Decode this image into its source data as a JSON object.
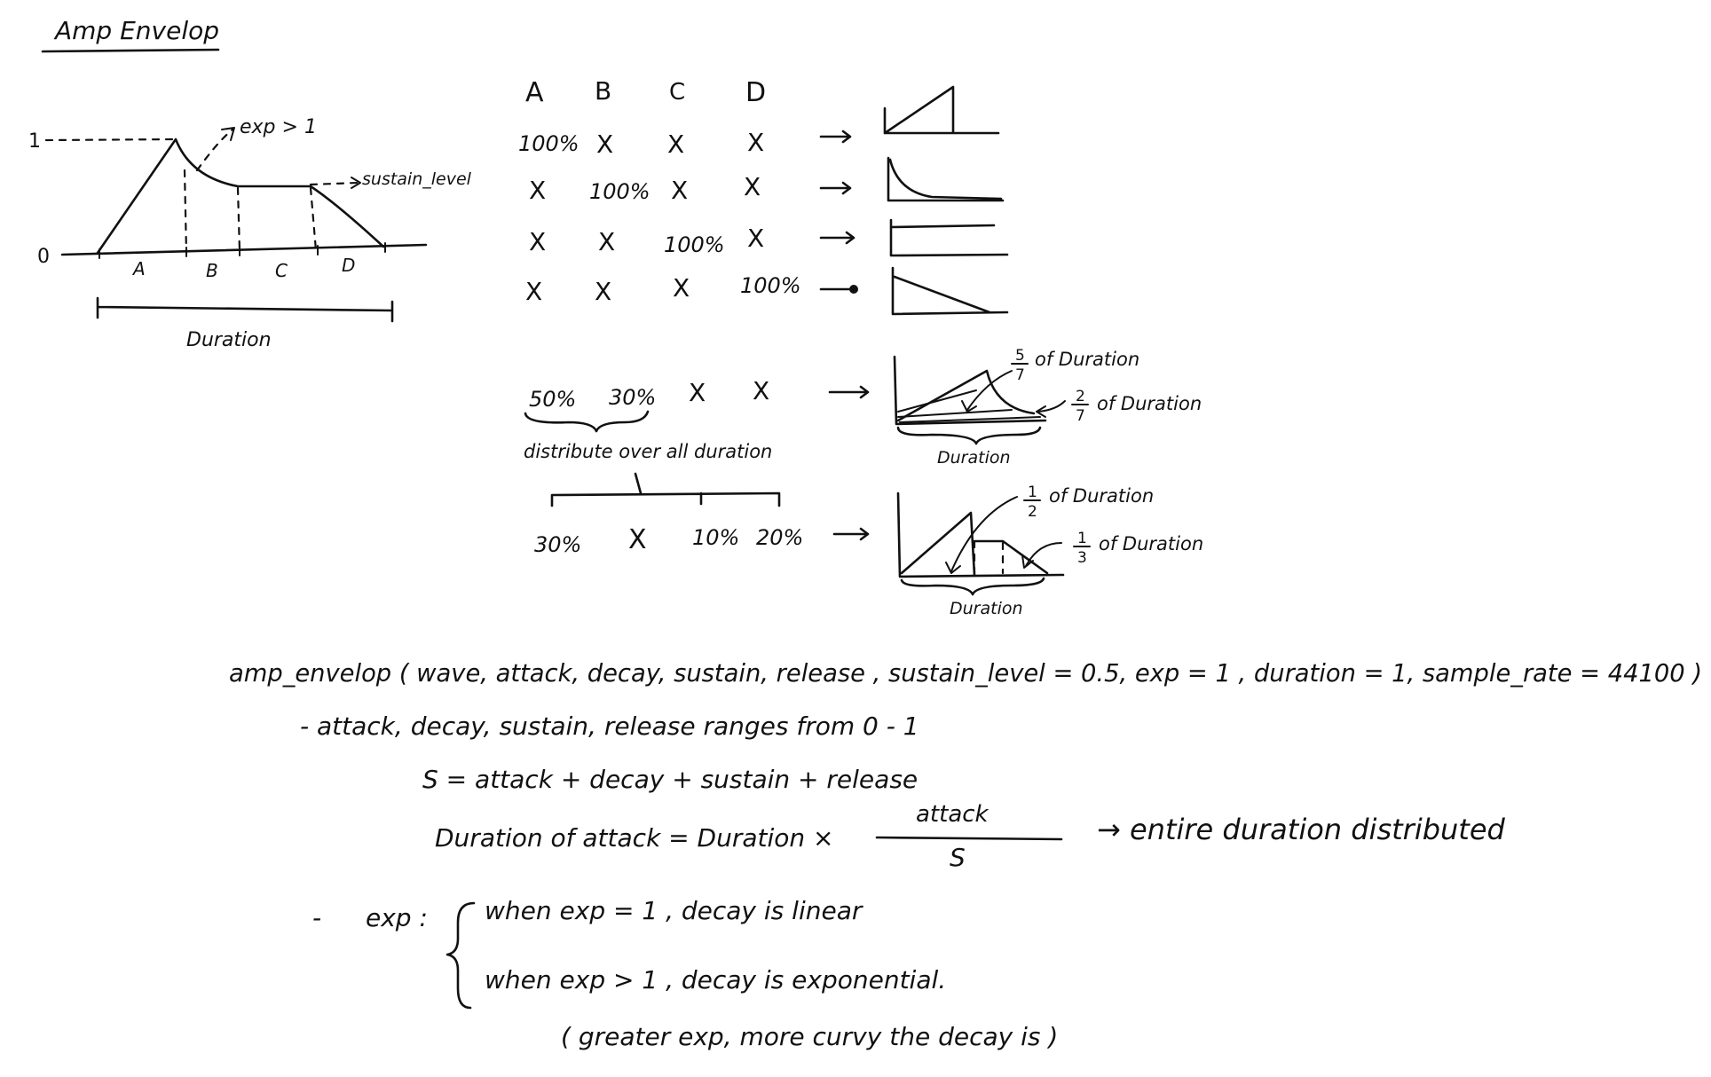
{
  "title": "Amp Envelop",
  "envelope_figure": {
    "y_tick_top": "1",
    "y_tick_bottom": "0",
    "exp_note": "exp > 1",
    "sustain_note": "sustain_level",
    "segments": [
      "A",
      "B",
      "C",
      "D"
    ],
    "duration_label": "Duration"
  },
  "table": {
    "headers": [
      "A",
      "B",
      "C",
      "D"
    ],
    "rows": [
      [
        "100%",
        "X",
        "X",
        "X"
      ],
      [
        "X",
        "100%",
        "X",
        "X"
      ],
      [
        "X",
        "X",
        "100%",
        "X"
      ],
      [
        "X",
        "X",
        "X",
        "100%"
      ]
    ]
  },
  "example1": {
    "values": [
      "50%",
      "30%",
      "X",
      "X"
    ],
    "note": "distribute over all duration",
    "frac1_num": "5",
    "frac1_den": "7",
    "frac1_text": "of Duration",
    "frac2_num": "2",
    "frac2_den": "7",
    "frac2_text": "of Duration",
    "brace_label": "Duration"
  },
  "example2": {
    "values": [
      "30%",
      "X",
      "10%",
      "20%"
    ],
    "frac1_num": "1",
    "frac1_den": "2",
    "frac1_text": "of Duration",
    "frac2_num": "1",
    "frac2_den": "3",
    "frac2_text": "of Duration",
    "brace_label": "Duration"
  },
  "notes": {
    "signature": "amp_envelop ( wave, attack, decay, sustain, release , sustain_level = 0.5, exp = 1 , duration = 1, sample_rate = 44100 )",
    "bullet1": "- attack, decay, sustain, release ranges from 0 - 1",
    "sum_line": "S = attack + decay + sustain + release",
    "dur_lhs": "Duration of attack = Duration ×",
    "dur_num": "attack",
    "dur_den": "S",
    "dur_rhs": "→ entire duration distributed",
    "exp_dash": "-",
    "exp_label": "exp :",
    "exp_case1": "when exp = 1 , decay is linear",
    "exp_case2": "when exp > 1 , decay is exponential.",
    "exp_note": "( greater exp, more curvy the decay is )"
  }
}
